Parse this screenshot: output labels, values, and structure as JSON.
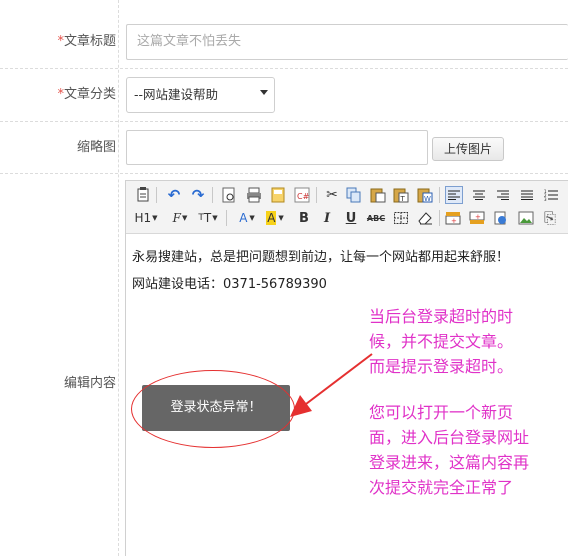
{
  "form": {
    "title_row": {
      "required_mark": "*",
      "label": "文章标题",
      "placeholder": "这篇文章不怕丢失"
    },
    "category_row": {
      "required_mark": "*",
      "label": "文章分类",
      "selected": "--网站建设帮助"
    },
    "thumb_row": {
      "label": "缩略图",
      "upload_label": "上传图片"
    },
    "content_row": {
      "label": "编辑内容"
    }
  },
  "editor": {
    "toolbar": {
      "heading_label": "H1",
      "font_family_label": "F",
      "font_size_label": "T",
      "font_color_label": "A",
      "highlight_label": "A",
      "bold_label": "B",
      "italic_label": "I",
      "underline_label": "U",
      "strike_label": "ABC"
    },
    "content": {
      "line1": "永易搜建站，总是把问题想到前边，让每一个网站都用起来舒服！",
      "line2": "网站建设电话：0371-56789390"
    }
  },
  "modal": {
    "message": "登录状态异常！"
  },
  "annotation": {
    "lines_a": [
      "当后台登录超时的时",
      "候，并不提交文章。",
      "而是提示登录超时。"
    ],
    "lines_b": [
      "您可以打开一个新页",
      "面，进入后台登录网址",
      "登录进来，这篇内容再",
      "次提交就完全正常了"
    ],
    "color": "#e032c8",
    "arrow_color": "#e53030"
  }
}
